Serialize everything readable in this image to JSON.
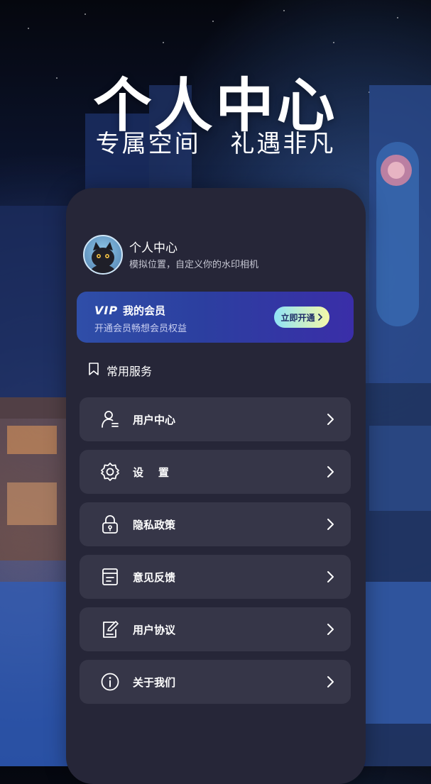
{
  "hero": {
    "title": "个人中心",
    "subtitle": "专属空间   礼遇非凡"
  },
  "profile": {
    "name": "个人中心",
    "description": "模拟位置，自定义你的水印相机",
    "avatar_icon": "cat-avatar"
  },
  "vip": {
    "logo": "VIP",
    "title": "我的会员",
    "description": "开通会员畅想会员权益",
    "button_label": "立即开通",
    "button_icon": "chevron-right-icon"
  },
  "section": {
    "title": "常用服务",
    "icon": "bookmark-icon"
  },
  "menu": [
    {
      "label": "用户中心",
      "icon": "user-icon"
    },
    {
      "label": "设    置",
      "icon": "gear-icon"
    },
    {
      "label": "隐私政策",
      "icon": "lock-icon"
    },
    {
      "label": "意见反馈",
      "icon": "feedback-icon"
    },
    {
      "label": "用户协议",
      "icon": "agreement-icon"
    },
    {
      "label": "关于我们",
      "icon": "info-icon"
    }
  ],
  "colors": {
    "panel": "#262638",
    "menu_item": "#363648",
    "vip_start": "#2f4ea8",
    "vip_end": "#3a2ea8",
    "button_start": "#8fe3f6",
    "button_end": "#f5f8a8"
  }
}
